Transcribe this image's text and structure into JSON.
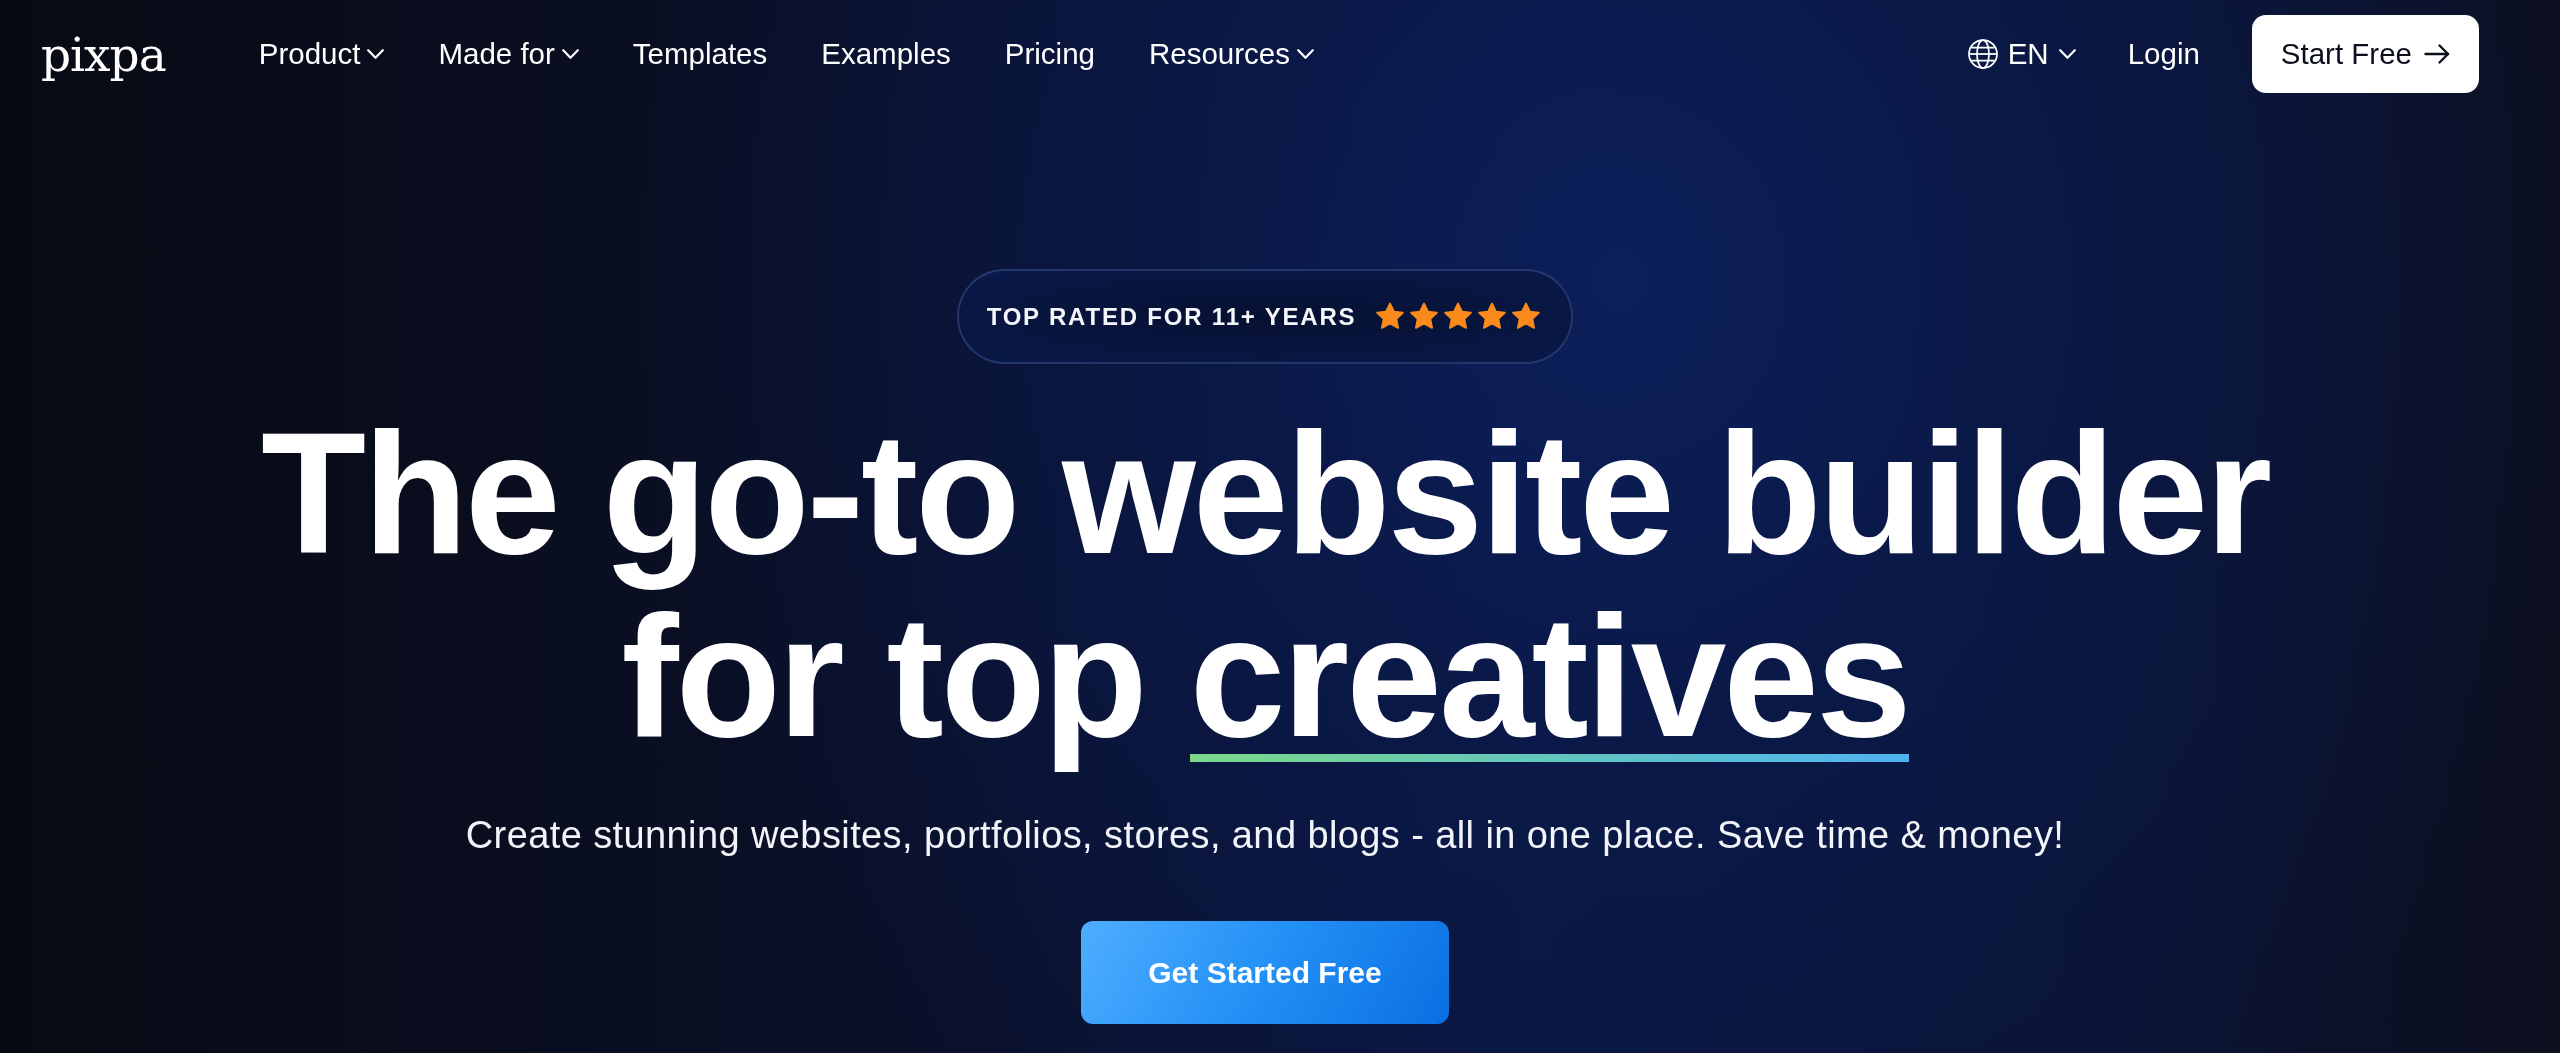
{
  "logo": "pixpa",
  "nav": {
    "items": [
      {
        "label": "Product",
        "has_menu": true
      },
      {
        "label": "Made for",
        "has_menu": true
      },
      {
        "label": "Templates",
        "has_menu": false
      },
      {
        "label": "Examples",
        "has_menu": false
      },
      {
        "label": "Pricing",
        "has_menu": false
      },
      {
        "label": "Resources",
        "has_menu": true
      }
    ],
    "language": {
      "label": "EN",
      "has_menu": true
    },
    "login": "Login",
    "cta": "Start Free"
  },
  "hero": {
    "badge": {
      "text": "TOP RATED FOR 11+ YEARS",
      "stars": 5
    },
    "heading": {
      "line_1": "The go-to website builder",
      "line_2": "for top",
      "underlined": "creatives"
    },
    "subtitle": "Create stunning websites, portfolios, stores, and blogs - all in one place. Save time & money!",
    "button": "Get Started Free"
  }
}
